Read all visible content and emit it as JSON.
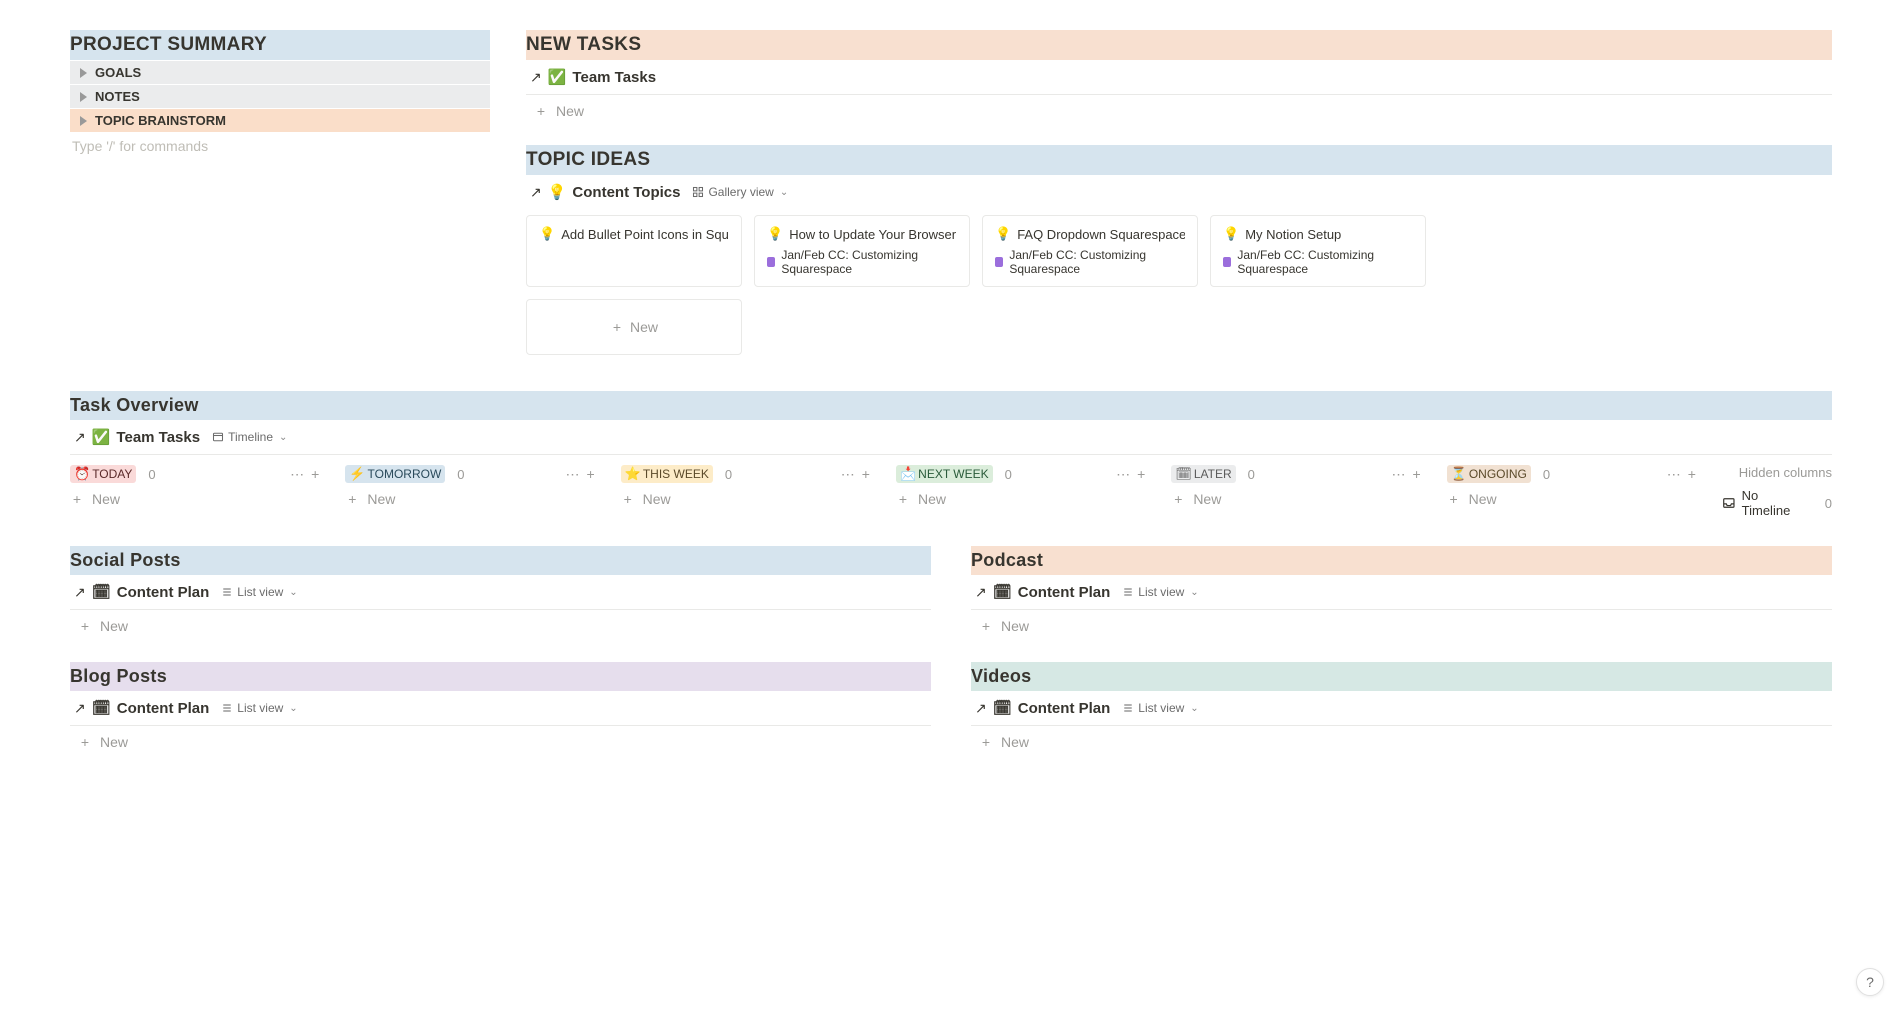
{
  "projectSummary": {
    "title": "PROJECT SUMMARY",
    "toggles": [
      "GOALS",
      "NOTES",
      "TOPIC BRAINSTORM"
    ],
    "placeholder": "Type '/' for commands"
  },
  "newTasks": {
    "title": "NEW TASKS",
    "link": "Team Tasks",
    "emoji": "✅",
    "newLabel": "New"
  },
  "topicIdeas": {
    "title": "TOPIC IDEAS",
    "link": "Content Topics",
    "emoji": "💡",
    "view": "Gallery view",
    "cards": [
      {
        "title": "Add Bullet Point Icons in Squares…",
        "sub": ""
      },
      {
        "title": "How to Update Your Browser Icon…",
        "sub": "Jan/Feb CC: Customizing Squarespace"
      },
      {
        "title": "FAQ Dropdown Squarespace",
        "sub": "Jan/Feb CC: Customizing Squarespace"
      },
      {
        "title": "My Notion Setup",
        "sub": "Jan/Feb CC: Customizing Squarespace"
      }
    ],
    "newLabel": "New"
  },
  "taskOverview": {
    "title": "Task Overview",
    "link": "Team Tasks",
    "emoji": "✅",
    "view": "Timeline",
    "columns": [
      {
        "icon": "⏰",
        "label": "TODAY",
        "tagClass": "tag-red",
        "count": "0"
      },
      {
        "icon": "⚡",
        "label": "TOMORROW",
        "tagClass": "tag-blue",
        "count": "0"
      },
      {
        "icon": "⭐",
        "label": "THIS WEEK",
        "tagClass": "tag-yellow",
        "count": "0"
      },
      {
        "icon": "📩",
        "label": "NEXT WEEK",
        "tagClass": "tag-green",
        "count": "0"
      },
      {
        "icon": "🗓",
        "label": "LATER",
        "tagClass": "tag-gray",
        "count": "0"
      },
      {
        "icon": "⏳",
        "label": "ONGOING",
        "tagClass": "tag-brown",
        "count": "0"
      }
    ],
    "newLabel": "New",
    "hiddenLabel": "Hidden columns",
    "noTimeline": "No Timeline",
    "noTimelineCount": "0"
  },
  "socialPosts": {
    "title": "Social Posts",
    "link": "Content Plan",
    "emoji": "🗓",
    "view": "List view",
    "newLabel": "New"
  },
  "podcast": {
    "title": "Podcast",
    "link": "Content Plan",
    "emoji": "🗓",
    "view": "List view",
    "newLabel": "New"
  },
  "blogPosts": {
    "title": "Blog Posts",
    "link": "Content Plan",
    "emoji": "🗓",
    "view": "List view",
    "newLabel": "New"
  },
  "videos": {
    "title": "Videos",
    "link": "Content Plan",
    "emoji": "🗓",
    "view": "List view",
    "newLabel": "New"
  },
  "helpLabel": "?"
}
